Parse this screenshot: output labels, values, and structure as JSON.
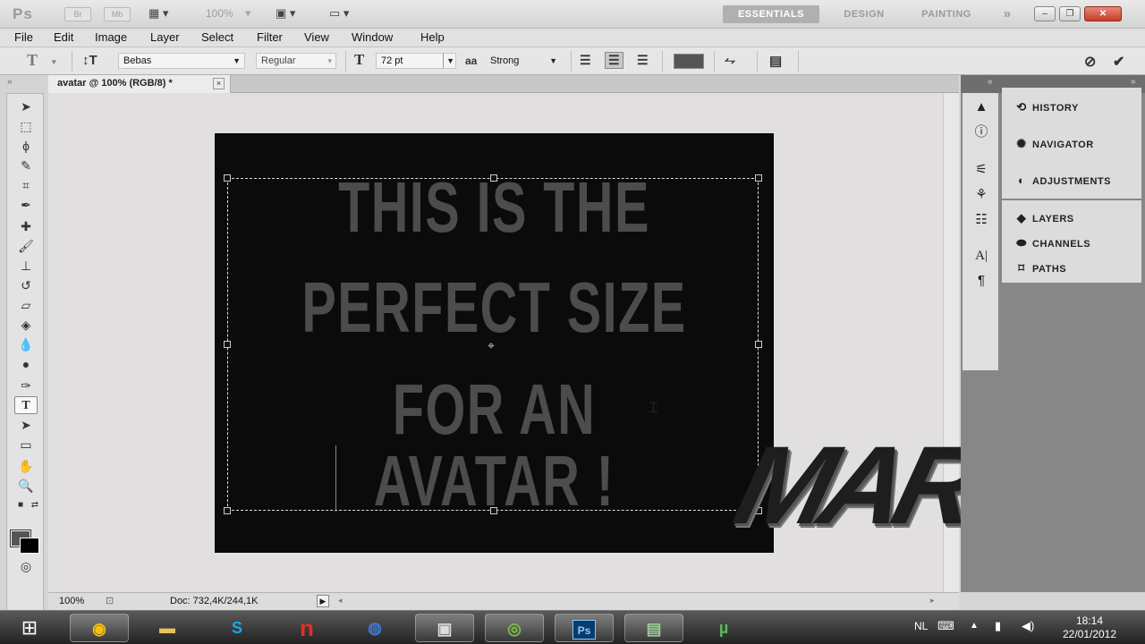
{
  "app": {
    "logo": "Ps",
    "bar_buttons": [
      "Br",
      "Mb"
    ],
    "zoom_display": "100%",
    "workspaces": [
      {
        "label": "ESSENTIALS",
        "active": true
      },
      {
        "label": "DESIGN",
        "active": false
      },
      {
        "label": "PAINTING",
        "active": false
      }
    ],
    "more": "»"
  },
  "menu": [
    "File",
    "Edit",
    "Image",
    "Layer",
    "Select",
    "Filter",
    "View",
    "Window",
    "Help"
  ],
  "options": {
    "font_family": "Bebas",
    "font_style": "Regular",
    "font_size": "72 pt",
    "antialias_label": "aa",
    "antialias": "Strong",
    "text_color": "#555555"
  },
  "document": {
    "tab_title": "avatar @ 100% (RGB/8) *",
    "close": "×",
    "canvas_bg": "#0b0b0b",
    "text_lines": [
      "THIS IS THE",
      "PERFECT SIZE",
      "FOR AN",
      "AVATAR !"
    ],
    "text_color": "#4c4c4c",
    "watermark": "MARA"
  },
  "status": {
    "zoom": "100%",
    "doc_info": "Doc: 732,4K/244,1K"
  },
  "panels": {
    "group1": [
      {
        "label": "HISTORY",
        "icon": "history-icon"
      },
      {
        "label": "NAVIGATOR",
        "icon": "navigator-icon"
      },
      {
        "label": "ADJUSTMENTS",
        "icon": "adjustments-icon"
      }
    ],
    "group2": [
      {
        "label": "LAYERS",
        "icon": "layers-icon"
      },
      {
        "label": "CHANNELS",
        "icon": "channels-icon"
      },
      {
        "label": "PATHS",
        "icon": "paths-icon"
      }
    ]
  },
  "taskbar": {
    "apps": [
      "chrome",
      "explorer",
      "skype",
      "n-app",
      "globe",
      "media",
      "spotify",
      "photoshop",
      "camtasia",
      "utorrent"
    ],
    "photoshop_label": "Ps",
    "lang": "NL",
    "time": "18:14",
    "date": "22/01/2012"
  }
}
